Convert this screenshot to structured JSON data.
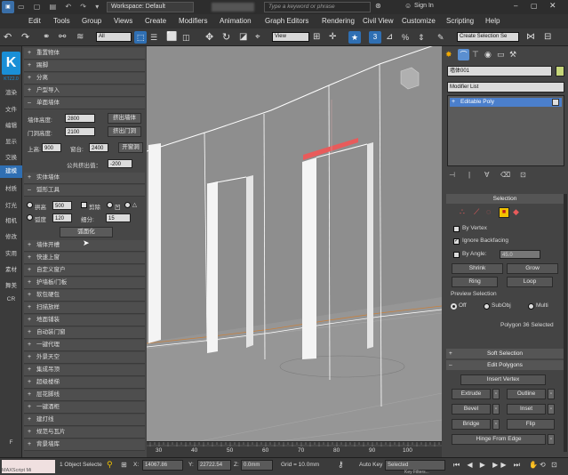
{
  "titlebar": {
    "workspace_label": "Workspace: Default",
    "search_placeholder": "Type a keyword or phrase",
    "sign_in_label": "Sign In"
  },
  "menu": [
    "Edit",
    "Tools",
    "Group",
    "Views",
    "Create",
    "Modifiers",
    "Animation",
    "Graph Editors",
    "Rendering",
    "Civil View",
    "Customize",
    "Scripting",
    "Help"
  ],
  "toolbar": {
    "filter_value": "All",
    "refcoord_value": "View",
    "selection_set_value": "Create Selection Se"
  },
  "leftbar": {
    "logo_letter": "K",
    "logo_caption": "KTZ2.0",
    "tabs": [
      "渲染",
      "文件",
      "编辑",
      "显示",
      "交换",
      "建模",
      "材质",
      "灯光",
      "相机",
      "修改",
      "实用",
      "素材",
      "舞美",
      "CR",
      "F"
    ]
  },
  "kpanel": {
    "rows_top": [
      "重置物体",
      "踢脚",
      "分离",
      "户型导入",
      "单面墙体"
    ],
    "wall_height_label": "墙体高度:",
    "wall_height_value": "2800",
    "extract_wall_btn": "挤出墙体",
    "door_height_label": "门洞高度:",
    "door_height_value": "2100",
    "extract_door_btn": "挤出门洞",
    "top_label": "上高:",
    "top_value": "900",
    "window_sill_label": "窗台:",
    "window_sill_value": "2400",
    "open_window_btn": "开窗洞",
    "extrude_label": "公共挤出值：",
    "extrude_value": "-200",
    "solid_wall_row": "实体墙体",
    "arc_tool_row": "弧形工具",
    "arch_label": "拱高",
    "arch_value": "500",
    "cb_label": "剪除",
    "concave_label": "凹",
    "arc_label": "弧度",
    "arc_value": "120",
    "segments_label": "细分:",
    "segments_value": "15",
    "arc_btn": "弧面化",
    "rows_bottom": [
      "墙体开槽",
      "快速上窗",
      "自定义窗户",
      "护墙板/门板",
      "软包硬包",
      "扫描放样",
      "地面铺装",
      "自动装门窗",
      "一键代理",
      "外景天空",
      "集成吊顶",
      "超级楼梯",
      "层花脚线",
      "一键酒柜",
      "建灯线",
      "规范与瓦片",
      "背景墙库"
    ]
  },
  "rightpanel": {
    "object_name": "墙体001",
    "modifier_list_label": "Modifier List",
    "stack_item": "Editable Poly",
    "selection_title": "Selection",
    "by_vertex": "By Vertex",
    "ignore_backfacing": "Ignore Backfacing",
    "by_angle": "By Angle:",
    "angle_value": "45.0",
    "shrink": "Shrink",
    "grow": "Grow",
    "ring": "Ring",
    "loop": "Loop",
    "preview_title": "Preview Selection",
    "off": "Off",
    "subobj": "SubObj",
    "multi": "Multi",
    "selected_status": "Polygon 36 Selected",
    "soft_selection": "Soft Selection",
    "edit_polygons": "Edit Polygons",
    "insert_vertex": "Insert Vertex",
    "extrude": "Extrude",
    "outline": "Outline",
    "bevel": "Bevel",
    "inset": "Inset",
    "bridge": "Bridge",
    "flip": "Flip",
    "hinge": "Hinge From Edge"
  },
  "timeline": {
    "ticks": [
      "30",
      "40",
      "50",
      "60",
      "70",
      "80",
      "90",
      "100"
    ]
  },
  "statusbar": {
    "script_label": "MAXScript Mi",
    "objects_selected": "1 Object Selecte",
    "x_label": "X:",
    "x_value": "14067.86",
    "y_label": "Y:",
    "y_value": "22722.54",
    "z_label": "Z:",
    "z_value": "0.0mm",
    "grid_label": "Grid = 10.0mm",
    "auto_key": "Auto Key",
    "selected_value": "Selected",
    "key_filters": "Key Filters..."
  },
  "colors": {
    "selection_highlight": "#e85b5b",
    "active_button": "#f2c200",
    "logo_blue": "#1a8fd6",
    "active_tab": "#2f6fb3"
  }
}
